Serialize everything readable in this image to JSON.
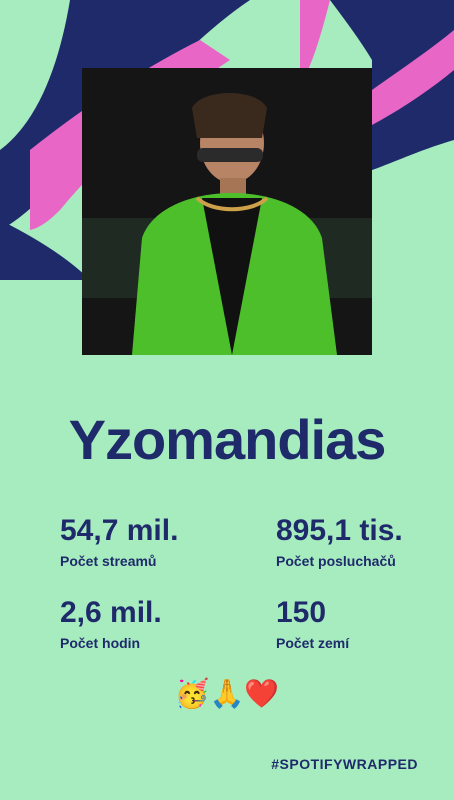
{
  "artist_name": "Yzomandias",
  "stats": [
    {
      "value": "54,7 mil.",
      "label": "Počet streamů"
    },
    {
      "value": "895,1 tis.",
      "label": "Počet posluchačů"
    },
    {
      "value": "2,6 mil.",
      "label": "Počet hodin"
    },
    {
      "value": "150",
      "label": "Počet zemí"
    }
  ],
  "emojis": "🥳🙏❤️",
  "hashtag": "#SPOTIFYWRAPPED",
  "colors": {
    "background": "#a6ecbf",
    "navy": "#1f2a6b",
    "pink": "#e867c6"
  },
  "image": {
    "description_icon": "artist-photo"
  }
}
